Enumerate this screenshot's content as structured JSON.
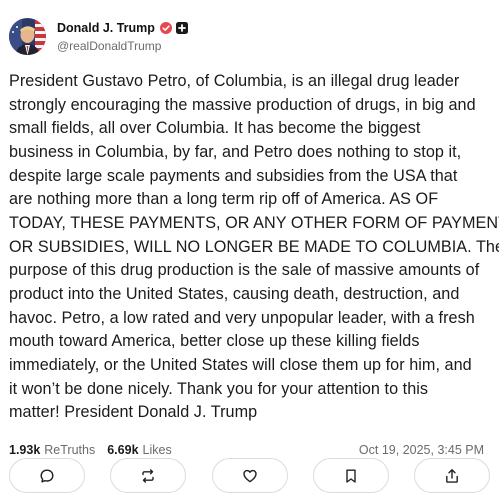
{
  "author": {
    "display_name": "Donald J. Trump",
    "handle": "@realDonaldTrump",
    "avatar_icon": "avatar-portrait",
    "verified_color": "#e5484d"
  },
  "post": {
    "lines": [
      "President Gustavo Petro, of Columbia, is an illegal drug leader",
      "strongly encouraging the massive production of drugs, in big and",
      "small fields, all over Columbia. It has become the biggest",
      "business in Columbia, by far, and Petro does nothing to stop it,",
      "despite large scale payments and subsidies from the USA that",
      "are nothing more than a long term rip off of America. AS OF",
      "TODAY, THESE PAYMENTS, OR ANY OTHER FORM OF PAYMENT,",
      "OR SUBSIDIES, WILL NO LONGER BE MADE TO COLUMBIA. The",
      "purpose of this drug production is the sale of massive amounts of",
      "product into the United States, causing death, destruction, and",
      "havoc. Petro, a low rated and very unpopular leader, with a fresh",
      "mouth toward America, better close up these killing fields",
      "immediately, or the United States will close them up for him, and",
      "it won’t be done nicely. Thank you for your attention to this",
      "matter! President Donald J. Trump"
    ]
  },
  "stats": {
    "retruths_count": "1.93k",
    "retruths_label": "ReTruths",
    "likes_count": "6.69k",
    "likes_label": "Likes",
    "timestamp": "Oct 19, 2025, 3:45 PM"
  },
  "actions": [
    {
      "name": "reply-button",
      "icon": "comment-icon"
    },
    {
      "name": "retruth-button",
      "icon": "repost-icon"
    },
    {
      "name": "like-button",
      "icon": "heart-icon"
    },
    {
      "name": "bookmark-button",
      "icon": "bookmark-icon"
    },
    {
      "name": "share-button",
      "icon": "share-icon"
    }
  ]
}
